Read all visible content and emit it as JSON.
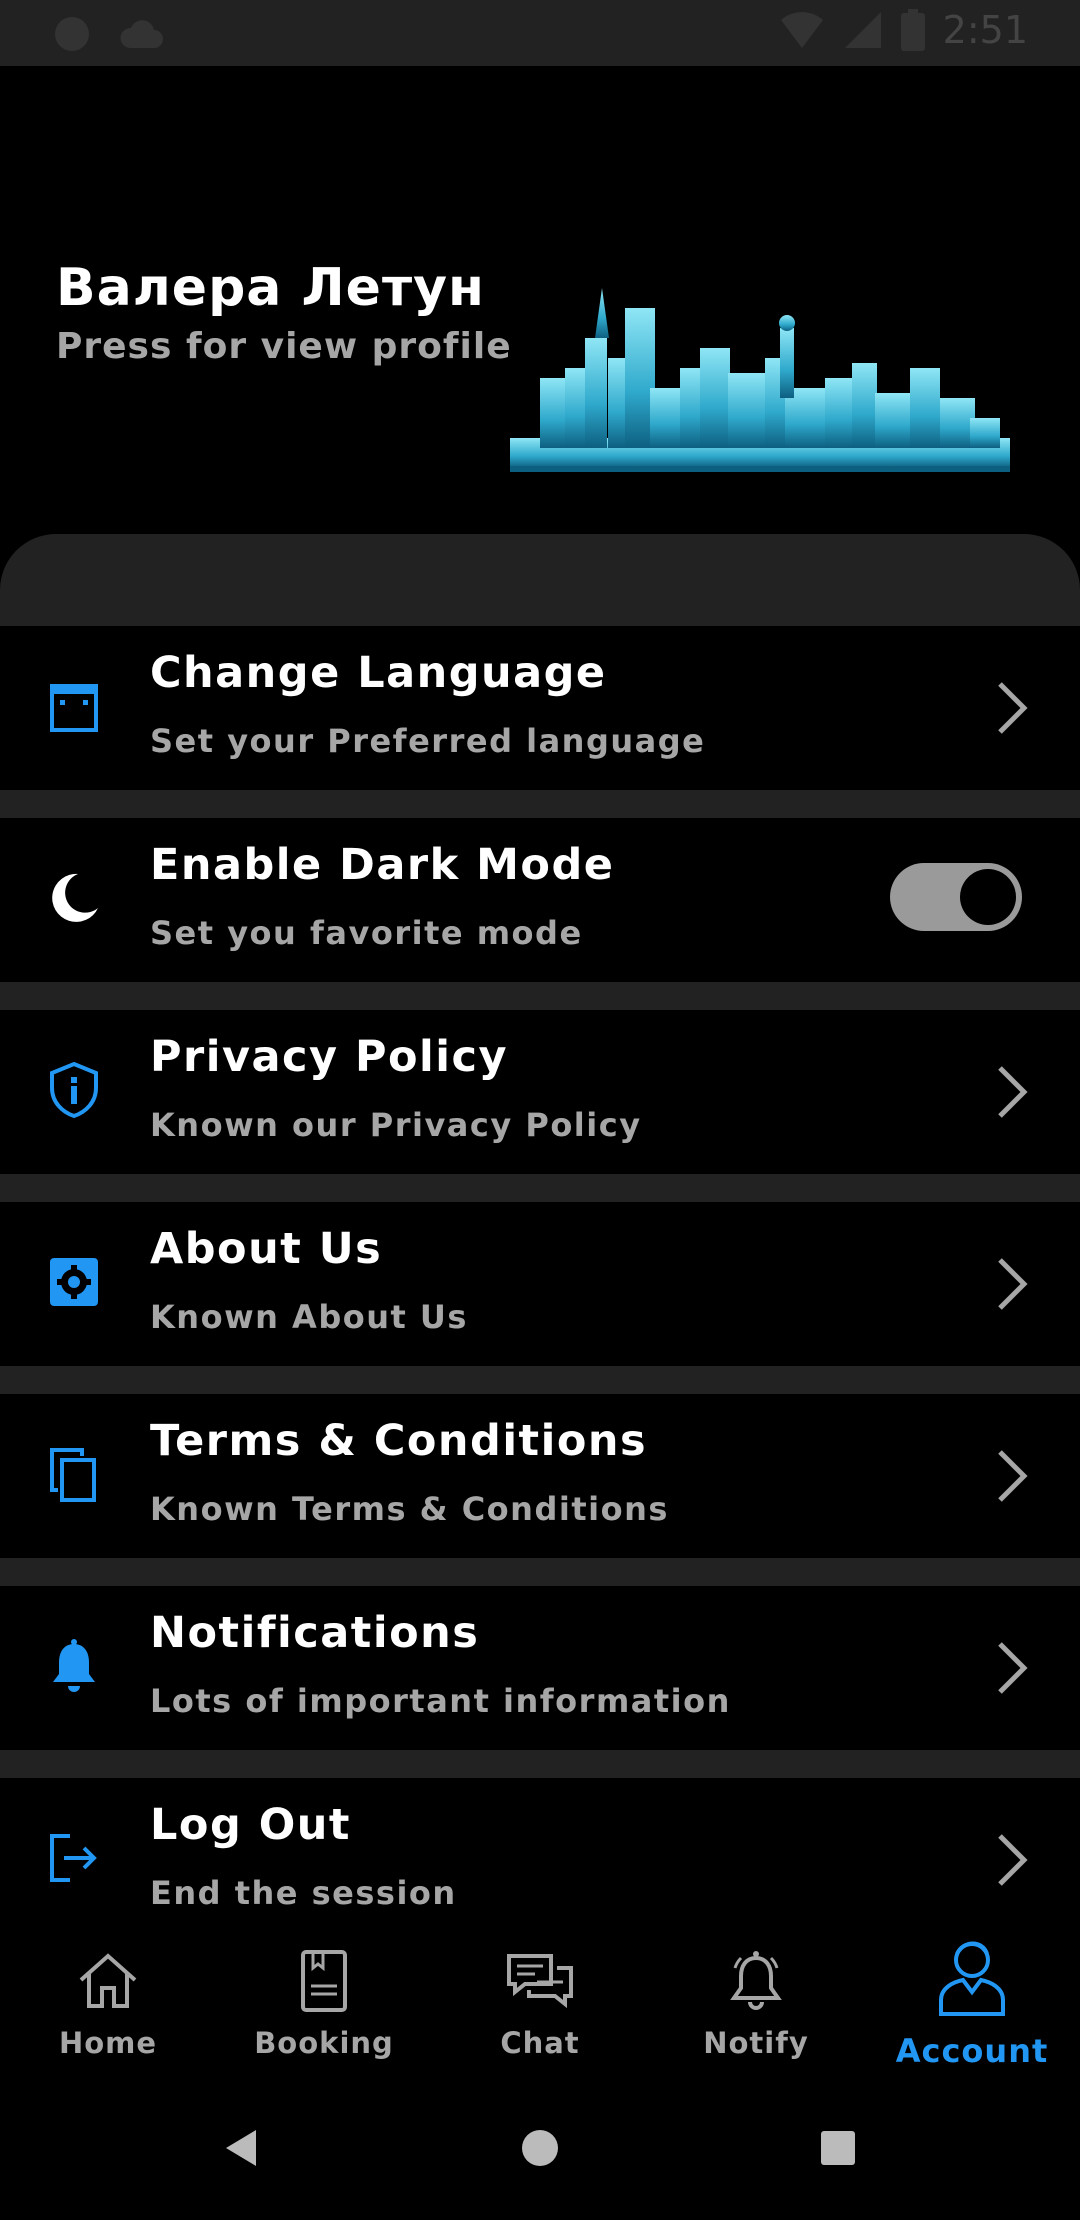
{
  "status_bar": {
    "time": "2:51"
  },
  "profile": {
    "name": "Валера Летун",
    "subtitle": "Press for view profile"
  },
  "menu": [
    {
      "title": "Change Language",
      "subtitle": "Set your Preferred language",
      "icon": "language-icon"
    },
    {
      "title": "Enable Dark Mode",
      "subtitle": "Set you favorite mode",
      "icon": "moon-icon",
      "toggle_on": true
    },
    {
      "title": "Privacy Policy",
      "subtitle": "Known our Privacy Policy",
      "icon": "shield-info-icon"
    },
    {
      "title": "About Us",
      "subtitle": "Known About Us",
      "icon": "settings-box-icon"
    },
    {
      "title": "Terms & Conditions",
      "subtitle": "Known Terms & Conditions",
      "icon": "copy-icon"
    },
    {
      "title": "Notifications",
      "subtitle": "Lots of important information",
      "icon": "bell-icon"
    },
    {
      "title": "Log Out",
      "subtitle": "End the session",
      "icon": "logout-icon"
    }
  ],
  "bottom_nav": [
    {
      "label": "Home",
      "icon": "home-icon"
    },
    {
      "label": "Booking",
      "icon": "book-icon"
    },
    {
      "label": "Chat",
      "icon": "chat-icon"
    },
    {
      "label": "Notify",
      "icon": "bell-outline-icon"
    },
    {
      "label": "Account",
      "icon": "account-icon",
      "active": true
    }
  ],
  "colors": {
    "accent": "#2196f3",
    "background": "#000000",
    "divider": "#222222",
    "secondary_text": "#a6a6a6"
  }
}
